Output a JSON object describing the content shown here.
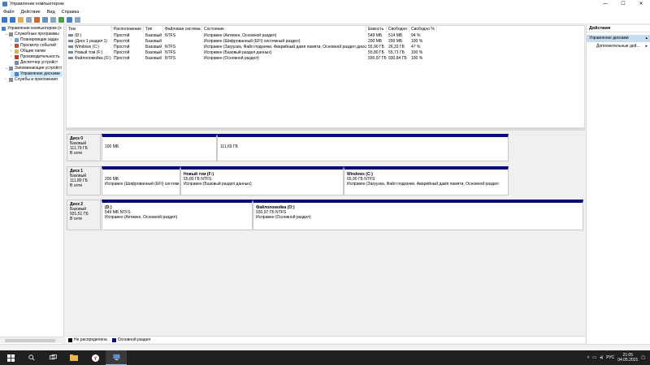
{
  "window": {
    "title": "Управление компьютером",
    "controls": {
      "minimize": "—",
      "maximize": "☐",
      "close": "✕"
    }
  },
  "menu": [
    "Файл",
    "Действие",
    "Вид",
    "Справка"
  ],
  "tree": {
    "root": "Управление компьютером (л",
    "items": [
      {
        "label": "Служебные программы",
        "depth": 1,
        "expanded": true
      },
      {
        "label": "Планировщик задан",
        "depth": 2
      },
      {
        "label": "Просмотр событий",
        "depth": 2
      },
      {
        "label": "Общие папки",
        "depth": 2
      },
      {
        "label": "Производительность",
        "depth": 2
      },
      {
        "label": "Диспетчер устройст",
        "depth": 2
      },
      {
        "label": "Запоминающие устройст",
        "depth": 1,
        "expanded": true
      },
      {
        "label": "Управление дисками",
        "depth": 2,
        "selected": true
      },
      {
        "label": "Службы и приложения",
        "depth": 1
      }
    ]
  },
  "volumes": {
    "columns": [
      "Том",
      "Расположение",
      "Тип",
      "Файловая система",
      "Состояние",
      "Емкость",
      "Свободно",
      "Свободно %"
    ],
    "rows": [
      [
        "(D:)",
        "Простой",
        "Базовый",
        "NTFS",
        "Исправен (Активен, Основной раздел)",
        "549 МБ",
        "514 МБ",
        "94 %"
      ],
      [
        "(Диск 1 раздел 1)",
        "Простой",
        "Базовый",
        "",
        "Исправен (Шифрованный (EFI) системный раздел)",
        "200 МБ",
        "200 МБ",
        "100 %"
      ],
      [
        "Windows (C:)",
        "Простой",
        "Базовый",
        "NTFS",
        "Исправен (Загрузка, Файл подкачки, Аварийный дамп памяти, Основной раздел диска)",
        "55,90 ГБ",
        "26,33 ГБ",
        "47 %"
      ],
      [
        "Новый том (F:)",
        "Простой",
        "Базовый",
        "NTFS",
        "Исправен (Базовый раздел данных)",
        "55,80 ГБ",
        "55,71 ГБ",
        "100 %"
      ],
      [
        "Файлопомойка (O:)",
        "Простой",
        "Базовый",
        "NTFS",
        "Исправен (Основной раздел)",
        "930,97 ГБ",
        "930,84 ГБ",
        "100 %"
      ]
    ]
  },
  "disks": [
    {
      "name": "Диск 0",
      "type": "Базовый",
      "size": "111,79 ГБ",
      "status": "В сети",
      "partitions": [
        {
          "title": "",
          "lines": [
            "100 МБ"
          ]
        },
        {
          "title": "",
          "lines": [
            "111,69 ГБ"
          ]
        }
      ]
    },
    {
      "name": "Диск 1",
      "type": "Базовый",
      "size": "111,80 ГБ",
      "status": "В сети",
      "partitions": [
        {
          "title": "",
          "lines": [
            "200 МБ",
            "Исправен (Шифрованный (EFI) системн"
          ]
        },
        {
          "title": "Новый том  (F:)",
          "lines": [
            "55,80 ГБ NTFS",
            "Исправен (Базовый раздел данных)"
          ]
        },
        {
          "title": "Windows  (C:)",
          "lines": [
            "55,90 ГБ NTFS",
            "Исправен (Загрузка, Файл подкачки, Аварийный дамп памяти, Основной раздел"
          ]
        }
      ]
    },
    {
      "name": "Диск 2",
      "type": "Базовый",
      "size": "931,51 ГБ",
      "status": "В сети",
      "partitions": [
        {
          "title": "(D:)",
          "lines": [
            "549 МБ NTFS",
            "Исправен (Активен, Основной раздел)"
          ]
        },
        {
          "title": "Файлопомойка  (O:)",
          "lines": [
            "930,97 ГБ NTFS",
            "Исправен (Основной раздел)"
          ]
        }
      ]
    }
  ],
  "legend": [
    {
      "label": "Не распределена",
      "color": "#000000"
    },
    {
      "label": "Основной раздел",
      "color": "#0a0a7d"
    }
  ],
  "actions": {
    "header": "Действия",
    "section": "Управление дисками",
    "item": "Дополнительные дей..."
  },
  "taskbar": {
    "language": "РУС",
    "time": "21:05",
    "date": "04.05.2021"
  }
}
